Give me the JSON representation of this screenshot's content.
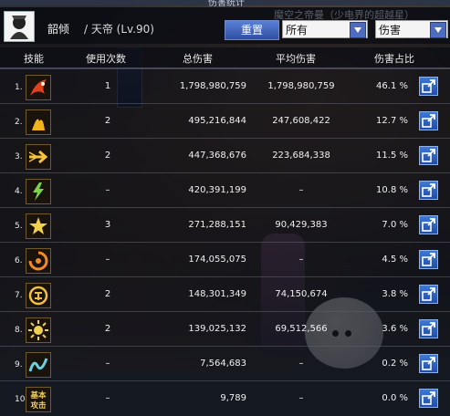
{
  "window_title": "伤害统计",
  "background_text": "魔空之帝曼（少电界的超越星）",
  "header": {
    "character_name": "韶倾",
    "character_class": "/ 天帝 (Lv.90)",
    "reset_button": "重置",
    "filter_select": "所有",
    "sort_select": "伤害"
  },
  "columns": {
    "skill": "技能",
    "uses": "使用次数",
    "total": "总伤害",
    "average": "平均伤害",
    "percent": "伤害占比"
  },
  "rows": [
    {
      "rank": "1.",
      "icon": "phoenix-skill-icon",
      "icon_color": "#e0401e",
      "uses": "1",
      "total": "1,798,980,759",
      "average": "1,798,980,759",
      "percent": "46.1 %"
    },
    {
      "rank": "2.",
      "icon": "flame-slash-skill-icon",
      "icon_color": "#f0b41e",
      "uses": "2",
      "total": "495,216,844",
      "average": "247,608,422",
      "percent": "12.7 %"
    },
    {
      "rank": "3.",
      "icon": "arrow-burst-skill-icon",
      "icon_color": "#f5c43a",
      "uses": "2",
      "total": "447,368,676",
      "average": "223,684,338",
      "percent": "11.5 %"
    },
    {
      "rank": "4.",
      "icon": "lightning-skill-icon",
      "icon_color": "#7ed24a",
      "uses": "–",
      "total": "420,391,199",
      "average": "–",
      "percent": "10.8 %"
    },
    {
      "rank": "5.",
      "icon": "star-strike-skill-icon",
      "icon_color": "#f2d04a",
      "uses": "3",
      "total": "271,288,151",
      "average": "90,429,383",
      "percent": "7.0 %"
    },
    {
      "rank": "6.",
      "icon": "shadow-whirl-skill-icon",
      "icon_color": "#f08a2a",
      "uses": "–",
      "total": "174,055,075",
      "average": "–",
      "percent": "4.5 %"
    },
    {
      "rank": "7.",
      "icon": "seal-ring-skill-icon",
      "icon_color": "#f0c040",
      "uses": "2",
      "total": "148,301,349",
      "average": "74,150,674",
      "percent": "3.8 %"
    },
    {
      "rank": "8.",
      "icon": "sun-skill-icon",
      "icon_color": "#f0d050",
      "uses": "2",
      "total": "139,025,132",
      "average": "69,512,566",
      "percent": "3.6 %"
    },
    {
      "rank": "9.",
      "icon": "spirit-wave-skill-icon",
      "icon_color": "#6ad0e0",
      "uses": "–",
      "total": "7,564,683",
      "average": "–",
      "percent": "0.2 %"
    },
    {
      "rank": "10.",
      "icon": "basic-attack-skill-icon",
      "icon_color": "#f0d060",
      "icon_text": "基本攻击",
      "uses": "–",
      "total": "9,789",
      "average": "–",
      "percent": "0.0 %"
    }
  ]
}
